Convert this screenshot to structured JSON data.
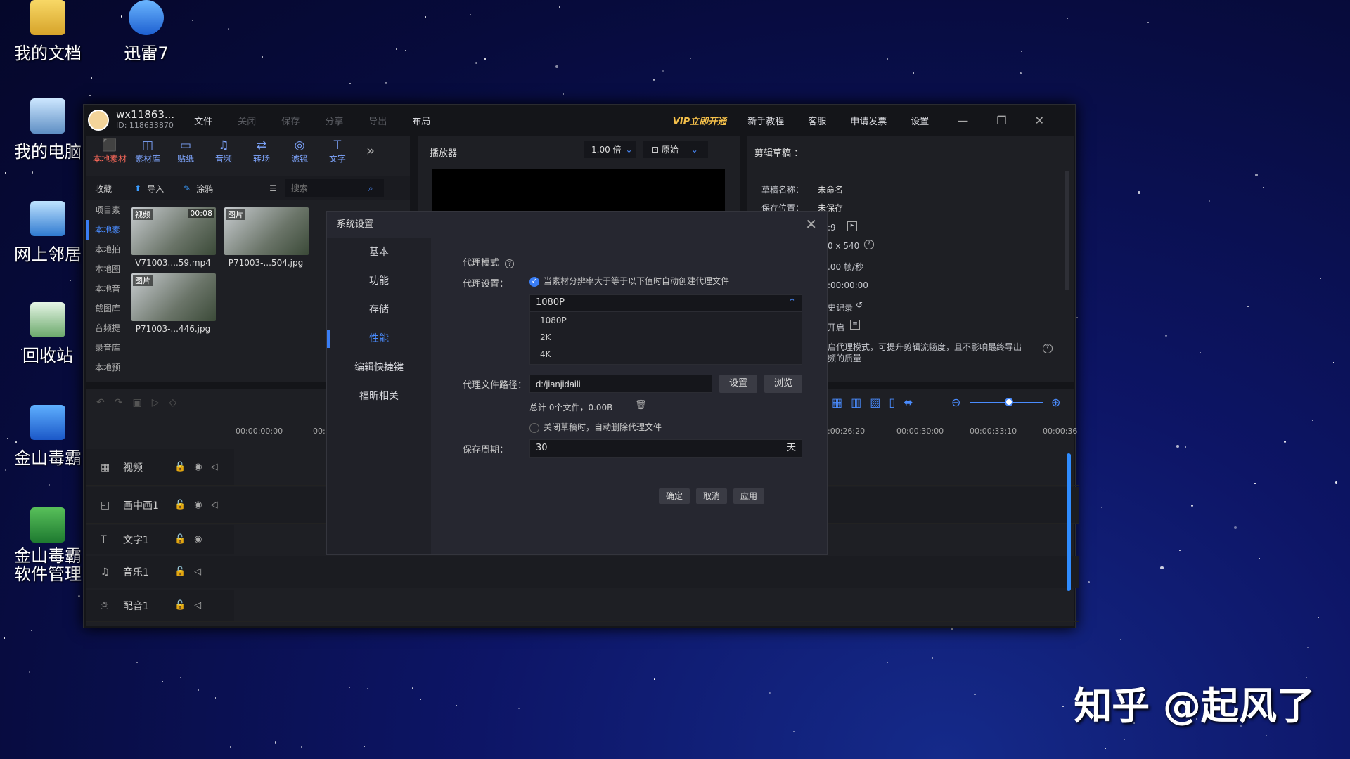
{
  "desktop": {
    "icons": [
      {
        "label": "我的文档"
      },
      {
        "label": "迅雷7"
      },
      {
        "label": "我的电脑"
      },
      {
        "label": "网上邻居"
      },
      {
        "label": "回收站"
      },
      {
        "label": "金山毒霸"
      },
      {
        "label": "金山毒霸软件管理"
      }
    ],
    "watermark": "知乎 @起风了"
  },
  "app": {
    "user": {
      "name": "wx11863...",
      "id": "ID: 118633870"
    },
    "menu": [
      "文件",
      "关闭",
      "保存",
      "分享",
      "导出",
      "布局"
    ],
    "right_menu": {
      "vip": "VIP立即开通",
      "tutorial": "新手教程",
      "service": "客服",
      "invoice": "申请发票",
      "settings": "设置"
    },
    "tools": [
      {
        "label": "本地素材",
        "icon": "⬛"
      },
      {
        "label": "素材库",
        "icon": "◫"
      },
      {
        "label": "贴纸",
        "icon": "▭"
      },
      {
        "label": "音频",
        "icon": "♫"
      },
      {
        "label": "转场",
        "icon": "⇄"
      },
      {
        "label": "滤镜",
        "icon": "◎"
      },
      {
        "label": "文字",
        "icon": "T"
      }
    ],
    "media_toolbar": {
      "fav": "收藏",
      "import": "导入",
      "paint": "涂鸦",
      "search_placeholder": "搜索"
    },
    "sidebar": [
      "项目素",
      "本地素",
      "本地拍",
      "本地图",
      "本地音",
      "截图库",
      "音频提",
      "录音库",
      "本地预"
    ],
    "media": [
      {
        "tag": "视频",
        "duration": "00:08",
        "name": "V71003....59.mp4"
      },
      {
        "tag": "图片",
        "name": "P71003-...504.jpg"
      },
      {
        "tag": "图片",
        "name": "P71003-...446.jpg"
      }
    ],
    "player": {
      "title": "播放器",
      "speed": "1.00 倍",
      "ratio": "原始"
    },
    "draft": {
      "title": "剪辑草稿 ：",
      "name_label": "草稿名称：",
      "name": "未命名",
      "loc_label": "保存位置：",
      "loc": "未保存",
      "ratio": ":9",
      "res": "0 x 540",
      "fps": ".00 帧/秒",
      "dur": ":00:00:00",
      "history": "史记录",
      "on": "开启",
      "proxy_tip": "启代理模式，可提升剪辑流畅度，且不影响最终导出",
      "proxy_tip2": "频的质量"
    },
    "timeline": {
      "times_left": [
        "00:00:00:00",
        "00:00"
      ],
      "times_right": [
        ":00:26:20",
        "00:00:30:00",
        "00:00:33:10",
        "00:00:36"
      ],
      "tracks": [
        "视频",
        "画中画1",
        "文字1",
        "音乐1",
        "配音1"
      ]
    }
  },
  "dialog": {
    "title": "系统设置",
    "nav": [
      "基本",
      "功能",
      "存储",
      "性能",
      "编辑快捷键",
      "福昕相关"
    ],
    "proxy_mode": "代理模式",
    "proxy_setting_label": "代理设置：",
    "proxy_auto_text": "当素材分辨率大于等于以下值时自动创建代理文件",
    "resolution_selected": "1080P",
    "resolution_options": [
      "1080P",
      "2K",
      "4K"
    ],
    "path_label": "代理文件路径：",
    "path_value": "d:/jianjidaili",
    "set_btn": "设置",
    "browse_btn": "浏览",
    "total": "总计 0个文件，0.00B",
    "auto_delete": "关闭草稿时，自动删除代理文件",
    "period_label": "保存周期：",
    "period_value": "30",
    "period_unit": "天",
    "ok": "确定",
    "cancel": "取消",
    "apply": "应用"
  }
}
